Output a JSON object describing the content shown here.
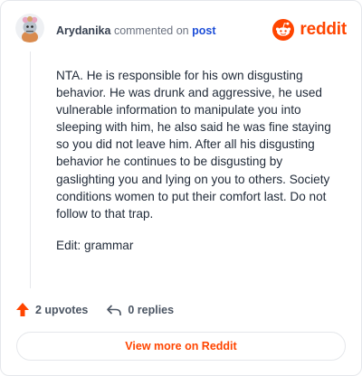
{
  "comment": {
    "author": "Arydanika",
    "action_text": "commented on",
    "post_link": "post",
    "paragraphs": [
      "NTA. He is responsible for his own disgusting behavior. He was drunk and aggressive, he used vulnerable information to manipulate you into sleeping with him, he also said he was fine staying so you did not leave him. After all his disgusting behavior he continues to be disgusting by gaslighting you and lying on you to others. Society conditions women to put their comfort last. Do not follow to that trap.",
      "Edit: grammar"
    ]
  },
  "brand": {
    "name": "reddit",
    "color": "#ff4500"
  },
  "actions": {
    "upvotes": "2 upvotes",
    "replies": "0 replies"
  },
  "footer": {
    "view_more": "View more on Reddit"
  }
}
